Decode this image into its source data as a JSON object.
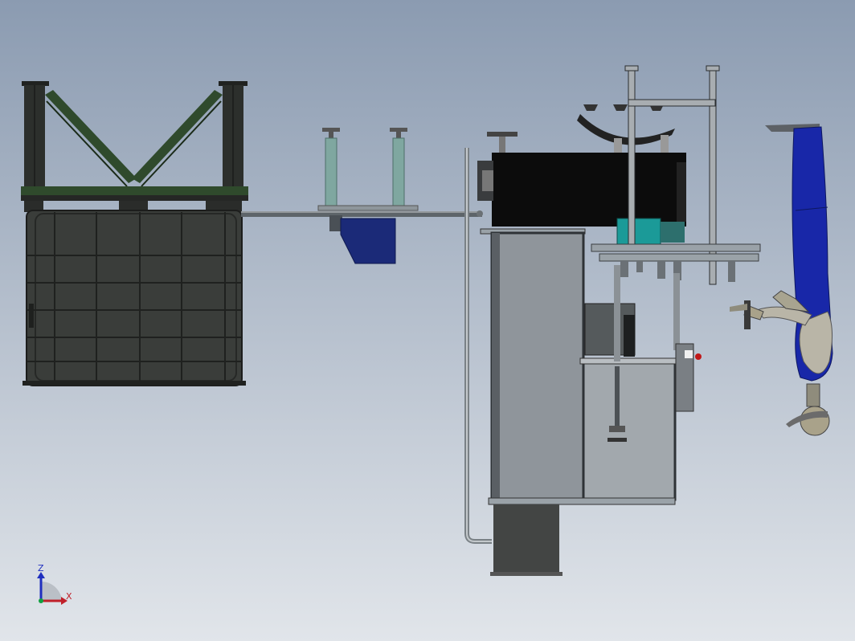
{
  "viewport": {
    "background_top": "#8b9bb1",
    "background_bottom": "#e1e5ea"
  },
  "colors": {
    "frame_dark": "#2c2f2c",
    "frame_green": "#2f4a2c",
    "tank": "#3a3d3a",
    "steel": "#9aa2a8",
    "steel_dark": "#5d6469",
    "machine_black": "#0c0c0c",
    "cabinet_fill": "#8f959b",
    "cabinet_lower": "#a2a8ad",
    "base_block": "#434544",
    "hopper_blue": "#1b2a78",
    "teal": "#1b9a98",
    "glass": "#7fa7a0",
    "worker_blue": "#1827a8",
    "skin": "#a9a28a",
    "axis_z": "#1f2fbf",
    "axis_x": "#c0202a",
    "axis_origin": "#10a040"
  },
  "triad": {
    "z_label": "Z",
    "x_label": "X"
  }
}
